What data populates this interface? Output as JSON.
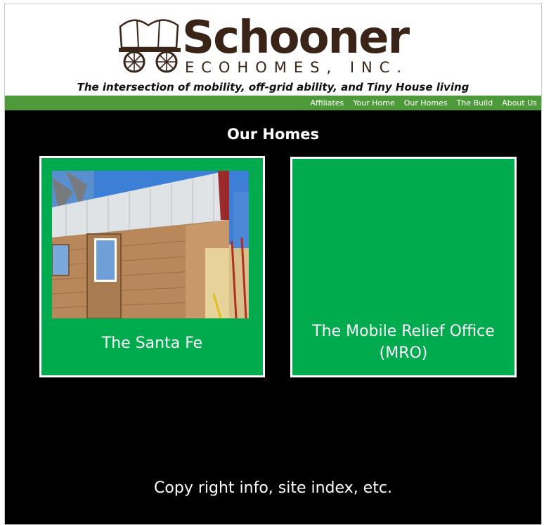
{
  "header": {
    "logo_word": "Schooner",
    "logo_sub": "ECOHOMES, INC.",
    "tagline": "The intersection of mobility, off-grid ability, and Tiny House living"
  },
  "nav": {
    "items": [
      {
        "label": "Affiliates"
      },
      {
        "label": "Your Home"
      },
      {
        "label": "Our Homes"
      },
      {
        "label": "The Build"
      },
      {
        "label": "About Us"
      }
    ]
  },
  "main": {
    "title": "Our Homes",
    "cards": [
      {
        "label": "The Santa Fe"
      },
      {
        "label_line1": "The Mobile Relief Office",
        "label_line2": "(MRO)"
      }
    ],
    "footer": "Copy right info, site index, etc."
  },
  "colors": {
    "nav_green": "#4e9a3b",
    "card_green": "#00ab4e",
    "logo_brown": "#3a2418",
    "background": "#000000"
  },
  "icons": [
    "covered-wagon-logo-icon"
  ]
}
